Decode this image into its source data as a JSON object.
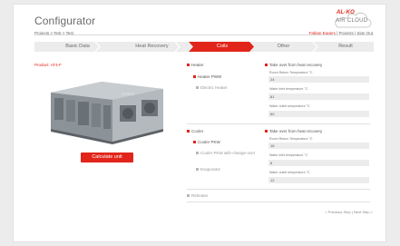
{
  "app": {
    "title": "Configurator"
  },
  "logo": {
    "brand": "AL-KO",
    "product": "AIR CLOUD"
  },
  "breadcrumb": "Projects > Test > Test",
  "userbar": {
    "user": "Fabian Eggers",
    "sep1": " | ",
    "projects": "Projects",
    "sep2": " | ",
    "signout": "Sign Out"
  },
  "steps": [
    {
      "label": "Basic Data",
      "active": false
    },
    {
      "label": "Heat Recovery",
      "active": false
    },
    {
      "label": "Coils",
      "active": true
    },
    {
      "label": "Other",
      "active": false
    },
    {
      "label": "Result",
      "active": false
    }
  ],
  "product": "Product: AT4-F",
  "calculate_label": "Calculate unit",
  "heater": {
    "title": "Heater",
    "options": [
      "Heater PWW",
      "Electric Heater"
    ],
    "takeover": "Take over from heat recovery",
    "fields": [
      {
        "label": "Room Return Temperature °C",
        "value": "24"
      },
      {
        "label": "Water inlet temperature °C",
        "value": "81"
      },
      {
        "label": "Water outlet temperature °C",
        "value": "60"
      }
    ]
  },
  "cooler": {
    "title": "Cooler",
    "options": [
      "Cooler PKW",
      "Cooler PKW with change-over",
      "Evaporator"
    ],
    "takeover": "Take over from heat recovery",
    "fields": [
      {
        "label": "Room Return Temperature °C",
        "value": "16"
      },
      {
        "label": "Water inlet temperature °C",
        "value": "6"
      },
      {
        "label": "Water outlet temperature °C",
        "value": "12"
      }
    ]
  },
  "reheater": {
    "title": "Reheater"
  },
  "pager": {
    "prev": "< Previous Step",
    "sep": " | ",
    "next": "Next Step >"
  },
  "colors": {
    "accent": "#e1251b",
    "step_bg": "#ececec",
    "input_bg": "#ececec"
  }
}
